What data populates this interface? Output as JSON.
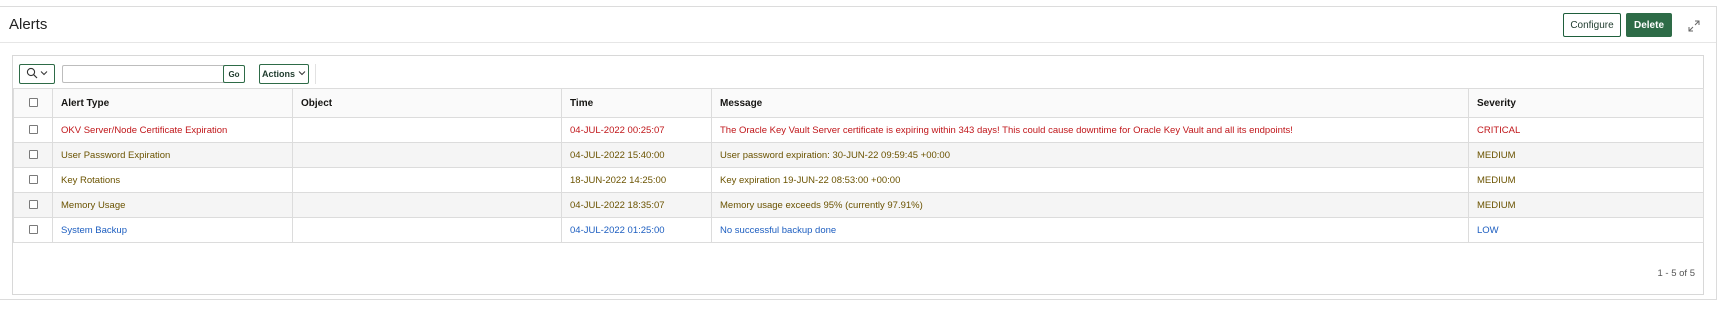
{
  "region": {
    "title": "Alerts",
    "configure_label": "Configure",
    "delete_label": "Delete"
  },
  "toolbar": {
    "search_value": "",
    "go_label": "Go",
    "actions_label": "Actions"
  },
  "grid": {
    "columns": [
      "Alert Type",
      "Object",
      "Time",
      "Message",
      "Severity"
    ],
    "rows": [
      {
        "alert_type": "OKV Server/Node Certificate Expiration",
        "object": "",
        "time": "04-JUL-2022 00:25:07",
        "message": "The Oracle Key Vault Server certificate is expiring within 343 days! This could cause downtime for Oracle Key Vault and all its endpoints!",
        "severity": "CRITICAL"
      },
      {
        "alert_type": "User Password Expiration",
        "object": "",
        "time": "04-JUL-2022 15:40:00",
        "message": "User  password expiration: 30-JUN-22 09:59:45 +00:00",
        "severity": "MEDIUM"
      },
      {
        "alert_type": "Key Rotations",
        "object": "",
        "time": "18-JUN-2022 14:25:00",
        "message": "Key expiration 19-JUN-22 08:53:00 +00:00",
        "severity": "MEDIUM"
      },
      {
        "alert_type": "Memory Usage",
        "object": "",
        "time": "04-JUL-2022 18:35:07",
        "message": "Memory usage exceeds 95% (currently 97.91%)",
        "severity": "MEDIUM"
      },
      {
        "alert_type": "System Backup",
        "object": "",
        "time": "04-JUL-2022 01:25:00",
        "message": "No successful backup done",
        "severity": "LOW"
      }
    ],
    "pagination": "1 - 5 of 5"
  },
  "colors": {
    "critical": "#c0161a",
    "medium": "#6b5300",
    "low": "#1d5ec0",
    "primary_button": "#2e6b47"
  },
  "icons": {
    "search": "search-icon",
    "expand": "expand-icon"
  }
}
